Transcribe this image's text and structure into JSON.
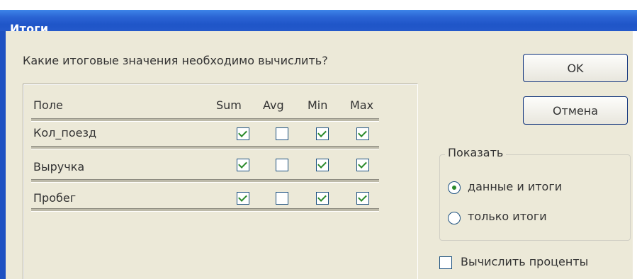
{
  "window": {
    "title": "Итоги"
  },
  "question": "Какие итоговые значения необходимо вычислить?",
  "table": {
    "headers": [
      "Поле",
      "Sum",
      "Avg",
      "Min",
      "Max"
    ],
    "rows": [
      {
        "field": "Кол_поезд",
        "sum": true,
        "avg": false,
        "min": true,
        "max": true
      },
      {
        "field": "Выручка",
        "sum": true,
        "avg": false,
        "min": true,
        "max": true
      },
      {
        "field": "Пробег",
        "sum": true,
        "avg": false,
        "min": true,
        "max": true
      }
    ]
  },
  "buttons": {
    "ok": "OK",
    "cancel": "Отмена"
  },
  "show_group": {
    "legend": "Показать",
    "options": [
      "данные и итоги",
      "только итоги"
    ],
    "selected_index": 0
  },
  "percent_checkbox": {
    "label": "Вычислить проценты",
    "checked": false
  }
}
